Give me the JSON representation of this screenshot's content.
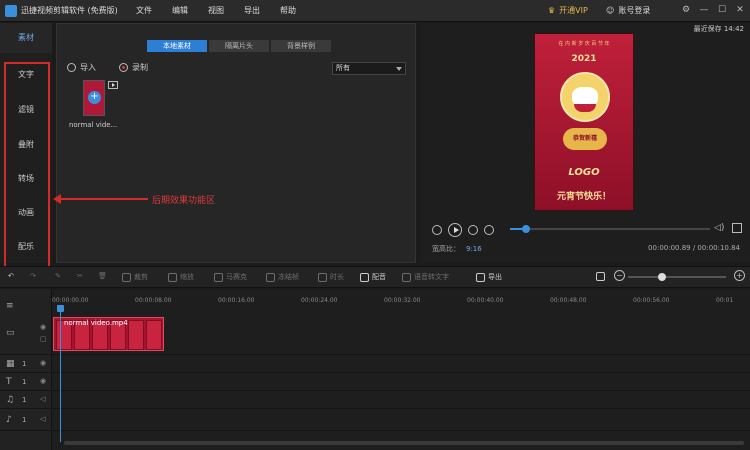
{
  "titlebar": {
    "title": "迅捷视频剪辑软件 (免费版)",
    "menu": [
      "文件",
      "编辑",
      "视图",
      "导出",
      "帮助"
    ],
    "vip": "开通VIP",
    "login": "账号登录"
  },
  "leftcol": {
    "top_tab": "素材",
    "tools": [
      "文字",
      "滤镜",
      "叠附",
      "转场",
      "动画",
      "配乐"
    ]
  },
  "library": {
    "tabs": [
      "本地素材",
      "隔离片头",
      "背景样例"
    ],
    "import_label": "导入",
    "record_label": "录制",
    "filter_value": "所有",
    "thumb_name": "normal vide..."
  },
  "annotation": {
    "label": "后期效果功能区",
    "color": "#d32a2a"
  },
  "preview": {
    "saved": "最近保存 14:42",
    "poster": {
      "top_text": "在 内 新 岁 庆 百 节 年",
      "year": "2021",
      "badge": "恭贺新禧",
      "logo": "LOGO",
      "slogan": "元宵节快乐！"
    },
    "seek_progress": 0.08,
    "aspect_label": "宽高比：",
    "aspect_value": "9:16",
    "time": "00:00:00.89 / 00:00:10.84"
  },
  "toolbar": {
    "items": [
      "裁剪",
      "缩放",
      "马赛克",
      "冻结帧",
      "时长",
      "配音",
      "语音转文字",
      "导出"
    ],
    "zoom_level": 0.35
  },
  "timeline": {
    "ruler": [
      "00:00:00.00",
      "00:00:08.00",
      "00:00:16.00",
      "00:00:24.00",
      "00:00:32.00",
      "00:00:40.00",
      "00:00:48.00",
      "00:00:56.00",
      "00:01"
    ],
    "clip_label": "normal video.mp4",
    "tracks": [
      {
        "num": ""
      },
      {
        "num": "1"
      },
      {
        "num": "1"
      },
      {
        "num": "1"
      },
      {
        "num": "1"
      }
    ]
  },
  "colors": {
    "accent": "#3a8fde",
    "highlight": "#d32a2a",
    "vip": "#e5b64d"
  }
}
